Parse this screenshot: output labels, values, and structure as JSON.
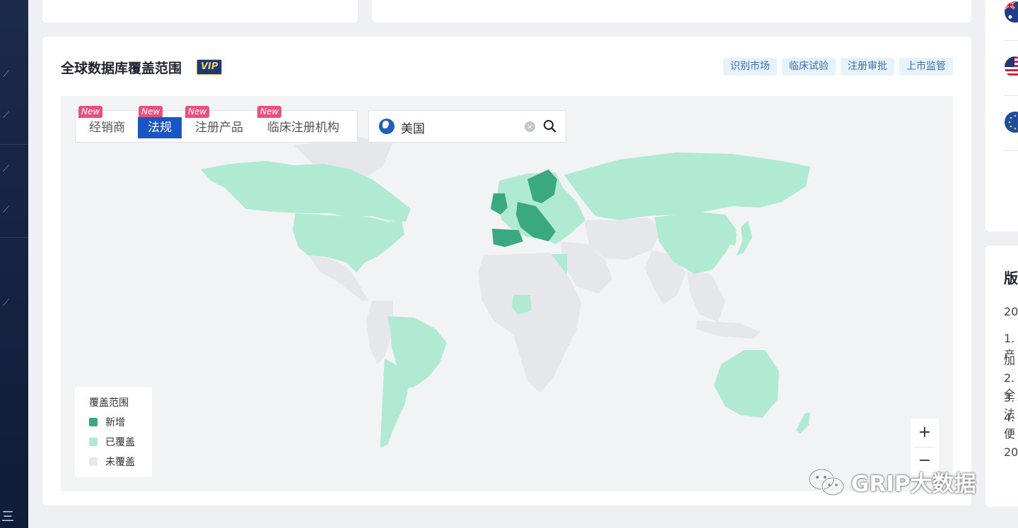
{
  "section": {
    "title": "全球数据库覆盖范围",
    "vip_label": "VIP",
    "tags": [
      "识别市场",
      "临床试验",
      "注册审批",
      "上市监管"
    ]
  },
  "tabs": [
    {
      "label": "经销商",
      "badge": "New",
      "active": false
    },
    {
      "label": "法规",
      "badge": "New",
      "active": true
    },
    {
      "label": "注册产品",
      "badge": "New",
      "active": false
    },
    {
      "label": "临床注册机构",
      "badge": "New",
      "active": false
    }
  ],
  "search": {
    "value": "美国",
    "globe_icon": "globe-icon",
    "clear_icon": "clear-icon",
    "search_icon": "search-icon"
  },
  "legend": {
    "title": "覆盖范围",
    "items": [
      {
        "label": "新增",
        "color": "#3aa982"
      },
      {
        "label": "已覆盖",
        "color": "#b1ead3"
      },
      {
        "label": "未覆盖",
        "color": "#e8e9ec"
      }
    ]
  },
  "map_colors": {
    "new": "#3aa982",
    "covered": "#b1ead3",
    "uncovered": "#e6e7ea",
    "ocean": "#f2f3f5"
  },
  "zoom": {
    "plus": "+",
    "minus": "−"
  },
  "right_panel": {
    "heading_fragment": "版",
    "lines": [
      "20",
      "1.产",
      "加",
      "2.全",
      "3.法",
      "4.便",
      "20"
    ]
  },
  "watermark": {
    "text": "GRIP大数据",
    "icon": "wechat-icon"
  },
  "sidebar": {
    "menu_glyph": "三"
  }
}
